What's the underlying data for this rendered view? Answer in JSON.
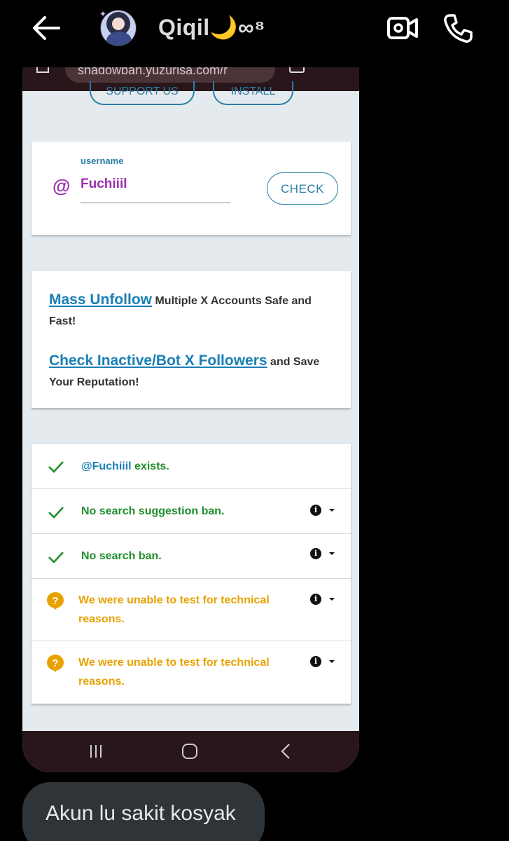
{
  "header": {
    "contact_name": "Qiqil🌙∞⁸",
    "icons": [
      "back-arrow-icon",
      "avatar",
      "video-call-icon",
      "phone-call-icon"
    ]
  },
  "screenshot": {
    "url": "shadowban.yuzurisa.com/r",
    "support_label": "SUPPORT US",
    "install_label": "INSTALL",
    "search": {
      "at_symbol": "@",
      "label": "username",
      "value": "Fuchiiil",
      "button": "CHECK"
    },
    "promo": {
      "link1": "Mass Unfollow",
      "text1": " Multiple X Accounts Safe and Fast!",
      "link2": "Check Inactive/Bot X Followers",
      "text2": " and Save Your Reputation!"
    },
    "results": {
      "exists_handle": "@Fuchiiil",
      "exists_text": " exists.",
      "suggestion_ban": "No search suggestion ban.",
      "search_ban": "No search ban.",
      "unable1": "We were unable to test for technical reasons.",
      "unable2": "We were unable to test for technical reasons.",
      "info_glyph": "i"
    }
  },
  "message": {
    "text": "Akun lu sakit kosyak"
  },
  "colors": {
    "ok": "#1f8f2c",
    "warn": "#e8a200",
    "link": "#1b7fb4",
    "username": "#9b2fae"
  }
}
